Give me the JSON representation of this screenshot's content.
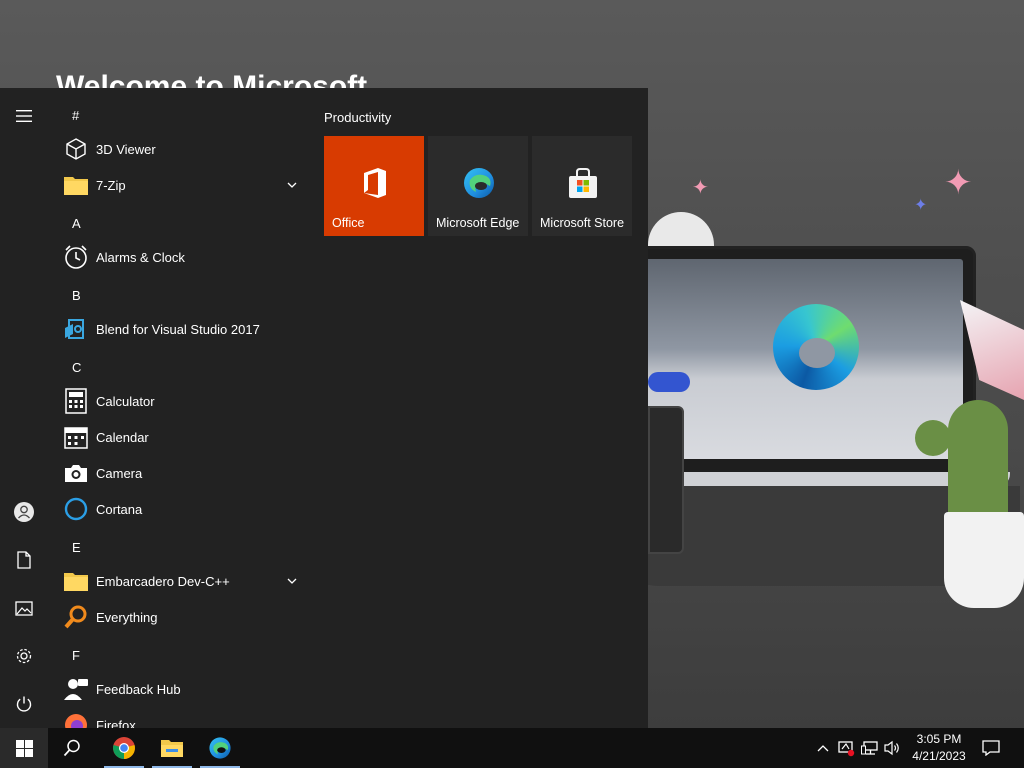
{
  "desktop": {
    "heading": "Welcome to Microsoft"
  },
  "start_menu": {
    "app_list": {
      "groups": [
        {
          "letter": "#",
          "apps": [
            {
              "label": "3D Viewer",
              "icon": "cube-icon"
            },
            {
              "label": "7-Zip",
              "icon": "folder-icon",
              "expandable": true
            }
          ]
        },
        {
          "letter": "A",
          "apps": [
            {
              "label": "Alarms & Clock",
              "icon": "alarm-clock-icon"
            }
          ]
        },
        {
          "letter": "B",
          "apps": [
            {
              "label": "Blend for Visual Studio 2017",
              "icon": "blend-icon"
            }
          ]
        },
        {
          "letter": "C",
          "apps": [
            {
              "label": "Calculator",
              "icon": "calculator-icon"
            },
            {
              "label": "Calendar",
              "icon": "calendar-icon"
            },
            {
              "label": "Camera",
              "icon": "camera-icon"
            },
            {
              "label": "Cortana",
              "icon": "cortana-ring-icon"
            }
          ]
        },
        {
          "letter": "E",
          "apps": [
            {
              "label": "Embarcadero Dev-C++",
              "icon": "folder-icon",
              "expandable": true
            },
            {
              "label": "Everything",
              "icon": "magnifier-icon"
            }
          ]
        },
        {
          "letter": "F",
          "apps": [
            {
              "label": "Feedback Hub",
              "icon": "feedback-person-icon"
            },
            {
              "label": "Firefox",
              "icon": "firefox-icon"
            }
          ]
        }
      ]
    },
    "tile_group": {
      "title": "Productivity",
      "tiles": [
        {
          "label": "Office",
          "icon": "office-icon",
          "color": "#d83b01"
        },
        {
          "label": "Microsoft Edge",
          "icon": "edge-icon",
          "color": "#2b2b2b"
        },
        {
          "label": "Microsoft Store",
          "icon": "store-bag-icon",
          "color": "#2b2b2b"
        }
      ]
    },
    "rail": [
      "hamburger-menu-icon",
      "user-account-icon",
      "documents-icon",
      "pictures-icon",
      "settings-gear-icon",
      "power-icon"
    ]
  },
  "taskbar": {
    "pinned": [
      "chrome-icon",
      "file-explorer-icon",
      "edge-icon"
    ],
    "clock": {
      "time": "3:05 PM",
      "date": "4/21/2023"
    }
  }
}
